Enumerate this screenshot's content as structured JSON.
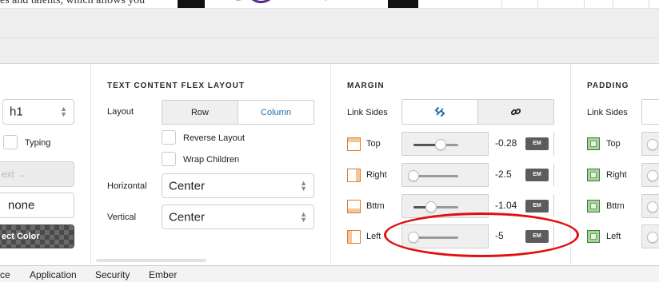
{
  "top": {
    "partial_text": "es and talents, which allows you"
  },
  "left_col": {
    "tag_select": "h1",
    "typing_label": "Typing",
    "text_button": "ext →",
    "none_select": "none",
    "color_button": "ect Color"
  },
  "flex": {
    "header": "TEXT CONTENT FLEX LAYOUT",
    "layout_label": "Layout",
    "row_label": "Row",
    "column_label": "Column",
    "reverse_label": "Reverse Layout",
    "wrap_label": "Wrap Children",
    "horizontal_label": "Horizontal",
    "horizontal_value": "Center",
    "vertical_label": "Vertical",
    "vertical_value": "Center"
  },
  "margin": {
    "header": "MARGIN",
    "link_sides_label": "Link Sides",
    "unlink_icon": "unlink-icon",
    "link_icon": "link-icon",
    "rows": [
      {
        "label": "Top",
        "value": "-0.28",
        "unit": "EM",
        "level": 0.6
      },
      {
        "label": "Right",
        "value": "-2.5",
        "unit": "EM",
        "level": 0.0
      },
      {
        "label": "Bttm",
        "value": "-1.04",
        "unit": "EM",
        "level": 0.4
      },
      {
        "label": "Left",
        "value": "-5",
        "unit": "EM",
        "level": 0.0
      }
    ]
  },
  "padding": {
    "header": "PADDING",
    "link_sides_label": "Link Sides",
    "rows": [
      {
        "label": "Top"
      },
      {
        "label": "Right"
      },
      {
        "label": "Bttm"
      },
      {
        "label": "Left"
      }
    ]
  },
  "tabs": [
    "ce",
    "Application",
    "Security",
    "Ember"
  ],
  "colors": {
    "accent_blue": "#1a6fb5",
    "margin_orange": "#e07b2a",
    "padding_green": "#3a7a3a",
    "annotation_red": "#e01010"
  }
}
